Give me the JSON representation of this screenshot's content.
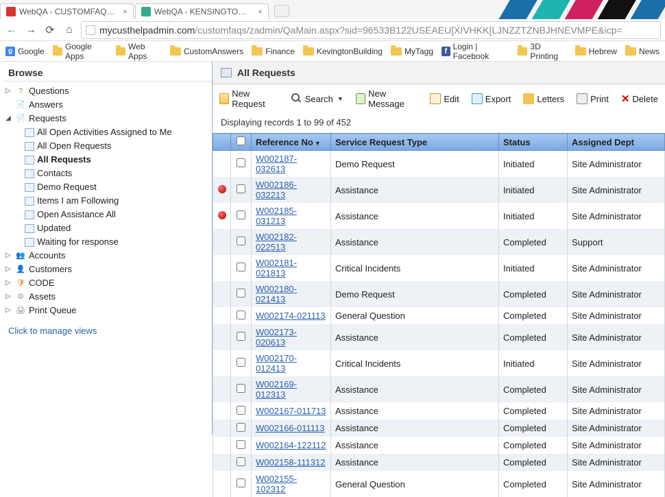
{
  "browser": {
    "tabs": [
      {
        "title": "WebQA - CUSTOMFAQS - JF"
      },
      {
        "title": "WebQA - KENSINGTONTESTI"
      }
    ],
    "url_host": "mycusthelpadmin.com",
    "url_path": "/customfaqs/zadmin/QaMain.aspx?sid=96533B122USEAEU[XIVHKK[LJNZZTZNBJHNEVMPE&icp=",
    "bookmarks": [
      {
        "label": "Google",
        "kind": "g"
      },
      {
        "label": "Google Apps",
        "kind": "folder"
      },
      {
        "label": "Web Apps",
        "kind": "folder"
      },
      {
        "label": "CustomAnswers",
        "kind": "folder"
      },
      {
        "label": "Finance",
        "kind": "folder"
      },
      {
        "label": "KevingtonBuilding",
        "kind": "folder"
      },
      {
        "label": "MyTagg",
        "kind": "folder"
      },
      {
        "label": "Login | Facebook",
        "kind": "fb"
      },
      {
        "label": "3D Printing",
        "kind": "folder"
      },
      {
        "label": "Hebrew",
        "kind": "folder"
      },
      {
        "label": "News",
        "kind": "folder"
      }
    ]
  },
  "sidebar": {
    "title": "Browse",
    "nodes": [
      {
        "label": "Questions",
        "icon": "q",
        "expander": "▷"
      },
      {
        "label": "Answers",
        "icon": "a",
        "expander": ""
      },
      {
        "label": "Requests",
        "icon": "r",
        "expander": "◢",
        "children": [
          "All Open Activities Assigned to Me",
          "All Open Requests",
          "All Requests",
          "Contacts",
          "Demo Request",
          "Items I am Following",
          "Open Assistance All",
          "Updated",
          "Waiting for response"
        ],
        "active_child": "All Requests"
      },
      {
        "label": "Accounts",
        "icon": "acc",
        "expander": "▷"
      },
      {
        "label": "Customers",
        "icon": "cust",
        "expander": "▷"
      },
      {
        "label": "CODE",
        "icon": "code",
        "expander": "▷"
      },
      {
        "label": "Assets",
        "icon": "assets",
        "expander": "▷"
      },
      {
        "label": "Print Queue",
        "icon": "print",
        "expander": "▷"
      }
    ],
    "manage_link": "Click to manage views"
  },
  "page": {
    "title": "All Requests",
    "toolbar": {
      "new_request": "New Request",
      "search": "Search",
      "new_message": "New Message",
      "edit": "Edit",
      "export": "Export",
      "letters": "Letters",
      "print": "Print",
      "delete": "Delete"
    },
    "records_info": "Displaying records 1 to 99 of 452",
    "columns": {
      "reference": "Reference No",
      "type": "Service Request Type",
      "status": "Status",
      "dept": "Assigned Dept"
    },
    "rows": [
      {
        "flag": false,
        "ref": "W002187-032613",
        "type": "Demo Request",
        "status": "Initiated",
        "dept": "Site Administrator"
      },
      {
        "flag": true,
        "ref": "W002186-032213",
        "type": "Assistance",
        "status": "Initiated",
        "dept": "Site Administrator"
      },
      {
        "flag": true,
        "ref": "W002185-031213",
        "type": "Assistance",
        "status": "Initiated",
        "dept": "Site Administrator"
      },
      {
        "flag": false,
        "ref": "W002182-022513",
        "type": "Assistance",
        "status": "Completed",
        "dept": "Support"
      },
      {
        "flag": false,
        "ref": "W002181-021813",
        "type": "Critical Incidents",
        "status": "Initiated",
        "dept": "Site Administrator"
      },
      {
        "flag": false,
        "ref": "W002180-021413",
        "type": "Demo Request",
        "status": "Completed",
        "dept": "Site Administrator"
      },
      {
        "flag": false,
        "ref": "W002174-021113",
        "type": "General Question",
        "status": "Completed",
        "dept": "Site Administrator"
      },
      {
        "flag": false,
        "ref": "W002173-020613",
        "type": "Assistance",
        "status": "Completed",
        "dept": "Site Administrator"
      },
      {
        "flag": false,
        "ref": "W002170-012413",
        "type": "Critical Incidents",
        "status": "Initiated",
        "dept": "Site Administrator"
      },
      {
        "flag": false,
        "ref": "W002169-012313",
        "type": "Assistance",
        "status": "Completed",
        "dept": "Site Administrator"
      },
      {
        "flag": false,
        "ref": "W002167-011713",
        "type": "Assistance",
        "status": "Completed",
        "dept": "Site Administrator"
      },
      {
        "flag": false,
        "ref": "W002166-011113",
        "type": "Assistance",
        "status": "Completed",
        "dept": "Site Administrator"
      },
      {
        "flag": false,
        "ref": "W002164-122112",
        "type": "Assistance",
        "status": "Completed",
        "dept": "Site Administrator"
      },
      {
        "flag": false,
        "ref": "W002158-111312",
        "type": "Assistance",
        "status": "Completed",
        "dept": "Site Administrator"
      },
      {
        "flag": false,
        "ref": "W002155-102312",
        "type": "General Question",
        "status": "Completed",
        "dept": "Site Administrator"
      }
    ]
  }
}
